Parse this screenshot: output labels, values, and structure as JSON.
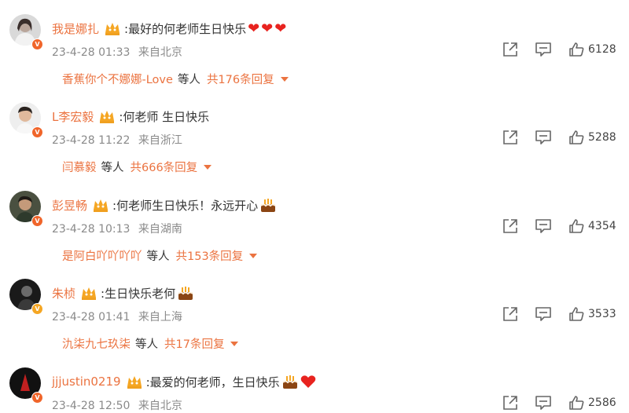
{
  "colors": {
    "username": "#eb7340",
    "badge_red": "#f0652a",
    "badge_gold": "#f5a623"
  },
  "comments": [
    {
      "user": "我是娜扎",
      "text": ":最好的何老师生日快乐",
      "emoji": "❤❤❤",
      "time": "23-4-28 01:33",
      "location": "来自北京",
      "replies_names": "香蕉你个不娜娜-Love",
      "replies_etc": "等人",
      "replies_count": "共176条回复",
      "likes": "6128",
      "badge": "red"
    },
    {
      "user": "L李宏毅",
      "text": ":何老师 生日快乐",
      "emoji": "",
      "time": "23-4-28 11:22",
      "location": "来自浙江",
      "replies_names": "闫慕毅",
      "replies_etc": "等人",
      "replies_count": "共666条回复",
      "likes": "5288",
      "badge": "red"
    },
    {
      "user": "彭昱畅",
      "text": ":何老师生日快乐！永远开心",
      "emoji": "cake",
      "time": "23-4-28 10:13",
      "location": "来自湖南",
      "replies_names": "是阿白吖吖吖吖",
      "replies_etc": "等人",
      "replies_count": "共153条回复",
      "likes": "4354",
      "badge": "red"
    },
    {
      "user": "朱桢",
      "text": ":生日快乐老何",
      "emoji": "cake",
      "time": "23-4-28 01:41",
      "location": "来自上海",
      "replies_names": "氿柒九七玖柒",
      "replies_etc": "等人",
      "replies_count": "共17条回复",
      "likes": "3533",
      "badge": "gold"
    },
    {
      "user": "jjjustin0219",
      "text": ":最爱的何老师，生日快乐",
      "emoji": "cake+heart",
      "time": "23-4-28 12:50",
      "location": "来自北京",
      "likes": "2586",
      "badge": "red"
    }
  ]
}
